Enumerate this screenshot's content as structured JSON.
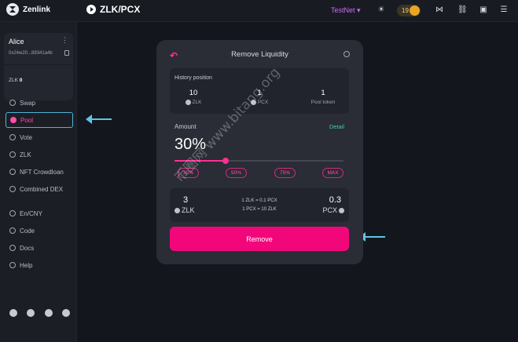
{
  "brand": {
    "name": "Zenlink"
  },
  "header": {
    "title": "ZLK/PCX",
    "network": "TestNet ▾",
    "points": "19"
  },
  "account": {
    "name": "Alice",
    "address": "0x24w20...89341a4b",
    "balance_label": "ZLK",
    "balance_value": "0"
  },
  "sidebar": {
    "items": [
      {
        "label": "Swap",
        "active": false
      },
      {
        "label": "Pool",
        "active": true
      },
      {
        "label": "Vote",
        "active": false
      },
      {
        "label": "ZLK",
        "active": false
      },
      {
        "label": "NFT Crowdloan",
        "active": false
      },
      {
        "label": "Combined DEX",
        "active": false
      },
      {
        "label": "En/CNY",
        "active": false
      },
      {
        "label": "Code",
        "active": false
      },
      {
        "label": "Docs",
        "active": false
      },
      {
        "label": "Help",
        "active": false
      }
    ]
  },
  "card": {
    "title": "Remove Liquidity",
    "history": {
      "title": "History position",
      "cols": [
        {
          "value": "10",
          "label": "ZLK"
        },
        {
          "value": "1",
          "label": "PCX"
        },
        {
          "value": "1",
          "label": "Pool token"
        }
      ]
    },
    "amount_label": "Amount",
    "detail_label": "Detail",
    "amount_value": "30%",
    "slider_fraction": 0.3,
    "presets": [
      "25%",
      "50%",
      "75%",
      "MAX"
    ],
    "result": {
      "left_value": "3",
      "left_label": "ZLK",
      "rate1": "1 ZLK = 0.1 PCX",
      "rate2": "1 PCX = 10 ZLK",
      "right_value": "0.3",
      "right_label": "PCX"
    },
    "remove_label": "Remove"
  },
  "watermark": "币圈网 www.bitang.org",
  "colors": {
    "accent": "#f2077b",
    "highlight": "#4fb3d6",
    "network": "#c86cf5",
    "detail": "#3fd0a0"
  }
}
